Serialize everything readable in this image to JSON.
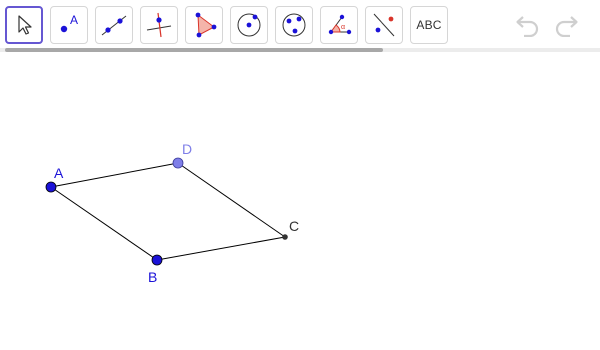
{
  "toolbar": {
    "text_tool_label": "ABC",
    "tools": [
      {
        "name": "move-tool",
        "icon": "arrow-cursor-icon",
        "active": true
      },
      {
        "name": "point-tool",
        "icon": "point-icon",
        "active": false
      },
      {
        "name": "line-tool",
        "icon": "line-icon",
        "active": false
      },
      {
        "name": "perpendicular-line-tool",
        "icon": "perpendicular-line-icon",
        "active": false
      },
      {
        "name": "polygon-tool",
        "icon": "polygon-icon",
        "active": false
      },
      {
        "name": "circle-center-point-tool",
        "icon": "circle-center-icon",
        "active": false
      },
      {
        "name": "circle-three-points-tool",
        "icon": "circle-three-points-icon",
        "active": false
      },
      {
        "name": "angle-tool",
        "icon": "angle-icon",
        "active": false
      },
      {
        "name": "reflect-tool",
        "icon": "reflect-icon",
        "active": false
      },
      {
        "name": "text-tool",
        "icon": "text-icon",
        "active": false
      }
    ],
    "undo_icon": "undo-icon",
    "redo_icon": "redo-icon"
  },
  "canvas": {
    "points": [
      {
        "label": "A",
        "color": "#1b12d8",
        "free": true
      },
      {
        "label": "B",
        "color": "#1b12d8",
        "free": true
      },
      {
        "label": "C",
        "color": "#333333",
        "free": false
      },
      {
        "label": "D",
        "color": "#7f7fe8",
        "free": true
      }
    ],
    "segments": [
      [
        "A",
        "D"
      ],
      [
        "D",
        "C"
      ],
      [
        "C",
        "B"
      ],
      [
        "B",
        "A"
      ]
    ]
  },
  "colors": {
    "accent": "#6557d2",
    "point_blue": "#1b12d8",
    "point_light_blue": "#7f7fe8",
    "segment": "#000000",
    "icon_red": "#d9352b"
  }
}
